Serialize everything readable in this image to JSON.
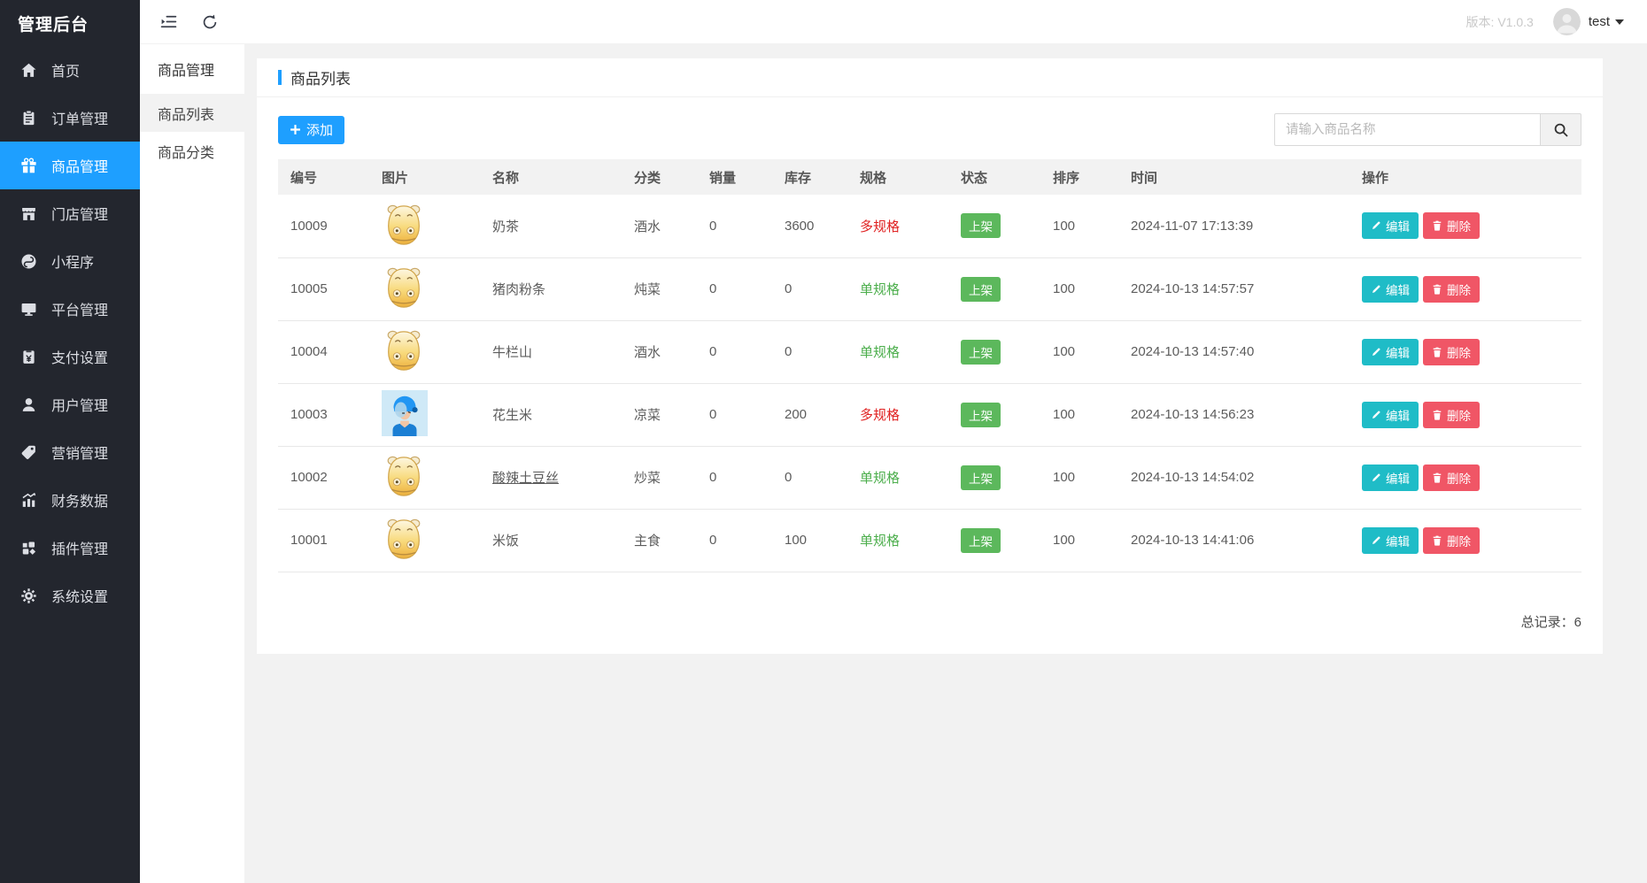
{
  "app": {
    "logo": "管理后台",
    "version_label": "版本: V1.0.3",
    "username": "test"
  },
  "sidebar": {
    "items": [
      {
        "label": "首页",
        "active": false
      },
      {
        "label": "订单管理",
        "active": false
      },
      {
        "label": "商品管理",
        "active": true
      },
      {
        "label": "门店管理",
        "active": false
      },
      {
        "label": "小程序",
        "active": false
      },
      {
        "label": "平台管理",
        "active": false
      },
      {
        "label": "支付设置",
        "active": false
      },
      {
        "label": "用户管理",
        "active": false
      },
      {
        "label": "营销管理",
        "active": false
      },
      {
        "label": "财务数据",
        "active": false
      },
      {
        "label": "插件管理",
        "active": false
      },
      {
        "label": "系统设置",
        "active": false
      }
    ]
  },
  "subnav": {
    "header": "商品管理",
    "items": [
      {
        "label": "商品列表",
        "active": true
      },
      {
        "label": "商品分类",
        "active": false
      }
    ]
  },
  "page": {
    "title": "商品列表",
    "add_button": "添加",
    "search_placeholder": "请输入商品名称",
    "total_label": "总记录：",
    "total": "6"
  },
  "table": {
    "headers": [
      "编号",
      "图片",
      "名称",
      "分类",
      "销量",
      "库存",
      "规格",
      "状态",
      "排序",
      "时间",
      "操作"
    ],
    "action_labels": {
      "edit": "编辑",
      "delete": "删除"
    },
    "rows": [
      {
        "id": "10009",
        "image": "hippo",
        "name": "奶茶",
        "category": "酒水",
        "sales": "0",
        "stock": "3600",
        "spec": "多规格",
        "spec_type": "multi",
        "status": "上架",
        "sort": "100",
        "time": "2024-11-07 17:13:39",
        "underlined": false
      },
      {
        "id": "10005",
        "image": "hippo",
        "name": "猪肉粉条",
        "category": "炖菜",
        "sales": "0",
        "stock": "0",
        "spec": "单规格",
        "spec_type": "single",
        "status": "上架",
        "sort": "100",
        "time": "2024-10-13 14:57:57",
        "underlined": false
      },
      {
        "id": "10004",
        "image": "hippo",
        "name": "牛栏山",
        "category": "酒水",
        "sales": "0",
        "stock": "0",
        "spec": "单规格",
        "spec_type": "single",
        "status": "上架",
        "sort": "100",
        "time": "2024-10-13 14:57:40",
        "underlined": false
      },
      {
        "id": "10003",
        "image": "rider",
        "name": "花生米",
        "category": "凉菜",
        "sales": "0",
        "stock": "200",
        "spec": "多规格",
        "spec_type": "multi",
        "status": "上架",
        "sort": "100",
        "time": "2024-10-13 14:56:23",
        "underlined": false
      },
      {
        "id": "10002",
        "image": "hippo",
        "name": "酸辣土豆丝",
        "category": "炒菜",
        "sales": "0",
        "stock": "0",
        "spec": "单规格",
        "spec_type": "single",
        "status": "上架",
        "sort": "100",
        "time": "2024-10-13 14:54:02",
        "underlined": true
      },
      {
        "id": "10001",
        "image": "hippo",
        "name": "米饭",
        "category": "主食",
        "sales": "0",
        "stock": "100",
        "spec": "单规格",
        "spec_type": "single",
        "status": "上架",
        "sort": "100",
        "time": "2024-10-13 14:41:06",
        "underlined": false
      }
    ]
  },
  "colors": {
    "accent": "#1E9FFF",
    "success_badge": "#5cb85c",
    "spec_multi": "#e02222",
    "spec_single": "#4cae4c",
    "edit_btn": "#1fbcc7",
    "delete_btn": "#f05666"
  }
}
